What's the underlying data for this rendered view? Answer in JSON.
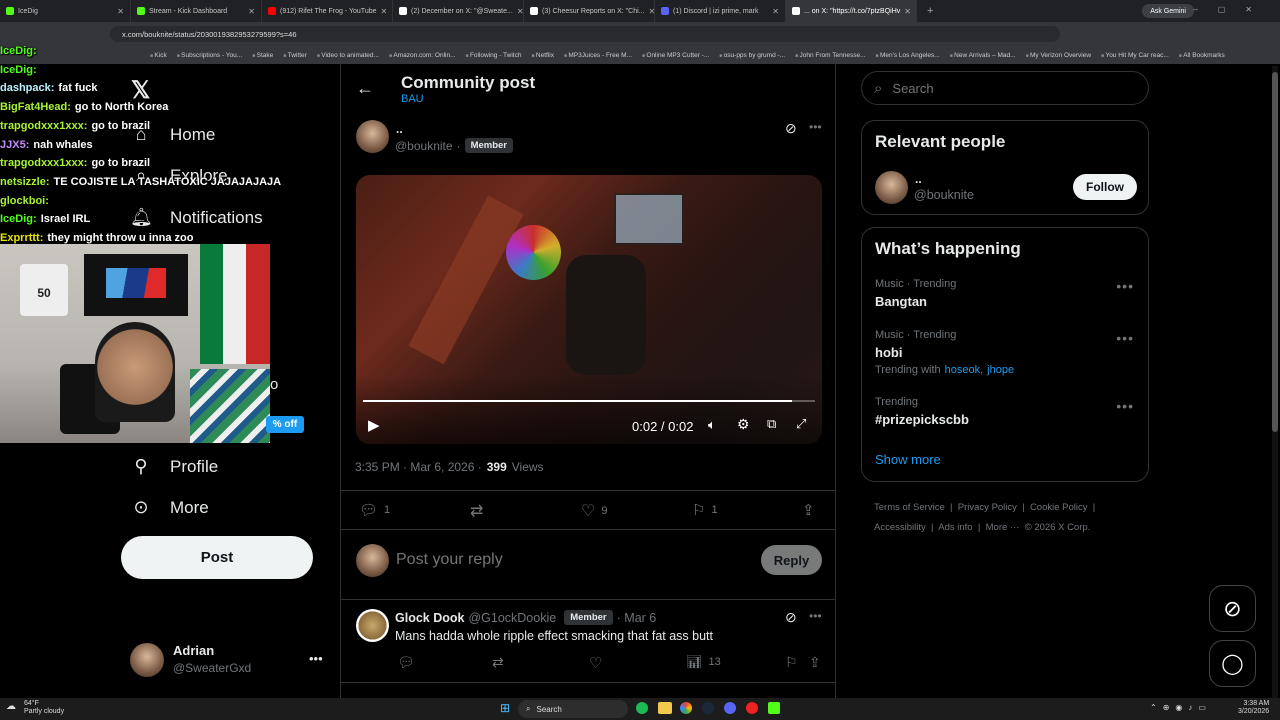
{
  "browser": {
    "tabs": [
      {
        "label": "IceDig",
        "color": "#53fc18"
      },
      {
        "label": "Stream - Kick Dashboard",
        "color": "#53fc18"
      },
      {
        "label": "(912) Rifet The Frog - YouTube",
        "color": "#ff0000"
      },
      {
        "label": "(2) December on X: \"@Sweate...",
        "color": "#ffffff"
      },
      {
        "label": "(3) Cheesur Reports on X: \"Chi...",
        "color": "#ffffff"
      },
      {
        "label": "(1) Discord | izi prime, mark",
        "color": "#5865f2"
      },
      {
        "label": "... on X: \"https://t.co/7ptzBQiHv",
        "color": "#ffffff"
      }
    ],
    "ask_gemini": "Ask Gemini",
    "url": "x.com/bouknite/status/2030019382953279599?s=46",
    "bookmarks": [
      "Kick",
      "Subscriptions - You...",
      "Stake",
      "Twitter",
      "Video to animated...",
      "Amazon.com: Onlin...",
      "Following - Twitch",
      "Netflix",
      "MP3Juices - Free M...",
      "Online MP3 Cutter -...",
      "osu-pps by grumd -...",
      "John From Tennesse...",
      "Men's Los Angeles...",
      "New Arrivals – Mad...",
      "My Verizon Overview",
      "You Hit My Car reac...",
      "All Bookmarks"
    ]
  },
  "chat": [
    {
      "user": "IceDig:",
      "msg": "",
      "color": "#53fc18"
    },
    {
      "user": "IceDig:",
      "msg": "",
      "color": "#53fc18"
    },
    {
      "user": "dashpack:",
      "msg": "fat fuck",
      "color": "#b9f2ff"
    },
    {
      "user": "BigFat4Head:",
      "msg": "go to North Korea",
      "color": "#a7f432"
    },
    {
      "user": "trapgodxxx1xxx:",
      "msg": "go to brazil",
      "color": "#a7f432"
    },
    {
      "user": "JJX5:",
      "msg": "nah whales",
      "color": "#c58cff"
    },
    {
      "user": "trapgodxxx1xxx:",
      "msg": "go to brazil",
      "color": "#a7f432"
    },
    {
      "user": "netsizzle:",
      "msg": "TE COJISTE LA TASHATOXIC JAJAJAJAJA",
      "color": "#a7f432"
    },
    {
      "user": "glockboi:",
      "msg": "",
      "color": "#a7f432"
    },
    {
      "user": "IceDig:",
      "msg": "Israel IRL",
      "color": "#53fc18"
    },
    {
      "user": "Exprrttt:",
      "msg": "they might throw u inna zoo",
      "color": "#e6e600"
    },
    {
      "user": "glockboi:",
      "msg": "",
      "color": "#a7f432"
    }
  ],
  "overlay": {
    "discount": "% off",
    "partial_o": "o"
  },
  "nav": {
    "home": "Home",
    "explore": "Explore",
    "notifications": "Notifications",
    "profile": "Profile",
    "more": "More",
    "post": "Post",
    "account_name": "Adrian",
    "account_handle": "@SweaterGxd"
  },
  "header": {
    "title": "Community post",
    "community": "BAU"
  },
  "post": {
    "author_name": "..",
    "author_handle": "@bouknite",
    "separator": "·",
    "member_badge": "Member",
    "video_time": "0:02 / 0:02",
    "video_progress": 1.0,
    "timestamp": "3:35 PM · Mar 6, 2026 ·",
    "views_count": "399",
    "views_label": "Views",
    "replies": "1",
    "reposts": "",
    "likes": "9",
    "bookmarks": "1"
  },
  "reply_box": {
    "placeholder": "Post your reply",
    "button": "Reply"
  },
  "reply": {
    "name": "Glock Dook",
    "handle": "@G1ockDookie",
    "badge": "Member",
    "date": "· Mar 6",
    "text": "Mans hadda whole ripple effect smacking that fat ass butt",
    "views": "13"
  },
  "sidebar": {
    "search_placeholder": "Search",
    "relevant_title": "Relevant people",
    "relevant_name": "..",
    "relevant_handle": "@bouknite",
    "follow": "Follow",
    "happening_title": "What’s happening",
    "trends": [
      {
        "category": "Music · Trending",
        "name": "Bangtan",
        "extra": ""
      },
      {
        "category": "Music · Trending",
        "name": "hobi",
        "extra": "Trending with"
      },
      {
        "category": "Trending",
        "name": "#prizepickscbb",
        "extra": ""
      }
    ],
    "trend_with_1": "hoseok",
    "trend_with_2": "jhope",
    "show_more": "Show more",
    "footer": [
      "Terms of Service",
      "Privacy Policy",
      "Cookie Policy",
      "Accessibility",
      "Ads info",
      "More ···",
      "© 2026 X Corp."
    ]
  },
  "taskbar": {
    "weather_temp": "64°F",
    "weather_desc": "Partly cloudy",
    "search": "Search",
    "time": "3:38 AM",
    "date": "3/20/2026"
  },
  "colors": {
    "accent": "#1d9bf0",
    "bg": "#000000",
    "border": "#2f3336",
    "muted": "#71767b"
  }
}
